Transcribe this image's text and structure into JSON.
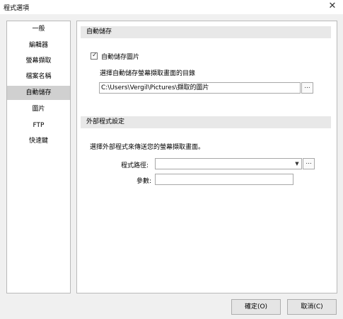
{
  "window": {
    "title": "程式選項",
    "close_icon": "close-icon"
  },
  "sidebar": {
    "selected_index": 4,
    "items": [
      {
        "label": "一般"
      },
      {
        "label": "編輯器"
      },
      {
        "label": "螢幕擷取"
      },
      {
        "label": "檔案名稱"
      },
      {
        "label": "自動儲存"
      },
      {
        "label": "圖片"
      },
      {
        "label": "FTP"
      },
      {
        "label": "快速鍵"
      }
    ]
  },
  "autosave": {
    "header": "自動儲存",
    "checkbox_label": "自動儲存圖片",
    "checked": true,
    "dir_label": "選擇自動儲存螢幕擷取畫面的目錄",
    "dir_value": "C:\\Users\\Vergil\\Pictures\\擷取的圖片",
    "browse_label": "..."
  },
  "external": {
    "header": "外部程式設定",
    "description": "選擇外部程式來傳送您的螢幕擷取畫面。",
    "path_label": "程式路徑:",
    "path_value": "",
    "browse_label": "...",
    "args_label": "參數:",
    "args_value": ""
  },
  "buttons": {
    "ok": "確定(O)",
    "cancel": "取消(C)"
  }
}
